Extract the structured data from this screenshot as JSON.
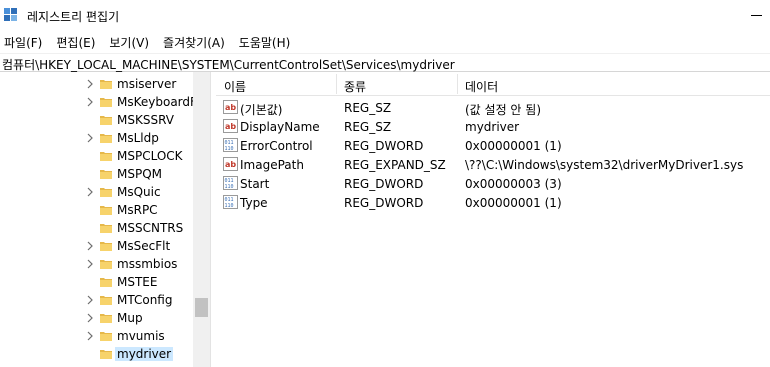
{
  "window": {
    "title": "레지스트리 편집기"
  },
  "menu": [
    "파일(F)",
    "편집(E)",
    "보기(V)",
    "즐겨찾기(A)",
    "도움말(H)"
  ],
  "address": "컴퓨터\\HKEY_LOCAL_MACHINE\\SYSTEM\\CurrentControlSet\\Services\\mydriver",
  "tree": {
    "items": [
      {
        "label": "msiserver",
        "expandable": true
      },
      {
        "label": "MsKeyboardFi",
        "expandable": true
      },
      {
        "label": "MSKSSRV",
        "expandable": false
      },
      {
        "label": "MsLldp",
        "expandable": true
      },
      {
        "label": "MSPCLOCK",
        "expandable": false
      },
      {
        "label": "MSPQM",
        "expandable": false
      },
      {
        "label": "MsQuic",
        "expandable": true
      },
      {
        "label": "MsRPC",
        "expandable": false
      },
      {
        "label": "MSSCNTRS",
        "expandable": false
      },
      {
        "label": "MsSecFlt",
        "expandable": true
      },
      {
        "label": "mssmbios",
        "expandable": true
      },
      {
        "label": "MSTEE",
        "expandable": false
      },
      {
        "label": "MTConfig",
        "expandable": true
      },
      {
        "label": "Mup",
        "expandable": true
      },
      {
        "label": "mvumis",
        "expandable": true
      },
      {
        "label": "mydriver",
        "expandable": false,
        "selected": true
      }
    ]
  },
  "list": {
    "headers": {
      "name": "이름",
      "type": "종류",
      "data": "데이터"
    },
    "rows": [
      {
        "icon": "string-value-icon",
        "name": "(기본값)",
        "type": "REG_SZ",
        "data": "(값 설정 안 됨)"
      },
      {
        "icon": "string-value-icon",
        "name": "DisplayName",
        "type": "REG_SZ",
        "data": "mydriver"
      },
      {
        "icon": "binary-value-icon",
        "name": "ErrorControl",
        "type": "REG_DWORD",
        "data": "0x00000001 (1)"
      },
      {
        "icon": "string-value-icon",
        "name": "ImagePath",
        "type": "REG_EXPAND_SZ",
        "data": "\\??\\C:\\Windows\\system32\\driverMyDriver1.sys"
      },
      {
        "icon": "binary-value-icon",
        "name": "Start",
        "type": "REG_DWORD",
        "data": "0x00000003 (3)"
      },
      {
        "icon": "binary-value-icon",
        "name": "Type",
        "type": "REG_DWORD",
        "data": "0x00000001 (1)"
      }
    ]
  },
  "colors": {
    "folder": "#f7d36b",
    "folder_dark": "#e6b84a",
    "string_icon": "#c0392b",
    "binary_icon": "#3a6fb5",
    "selection": "#cce8ff"
  }
}
